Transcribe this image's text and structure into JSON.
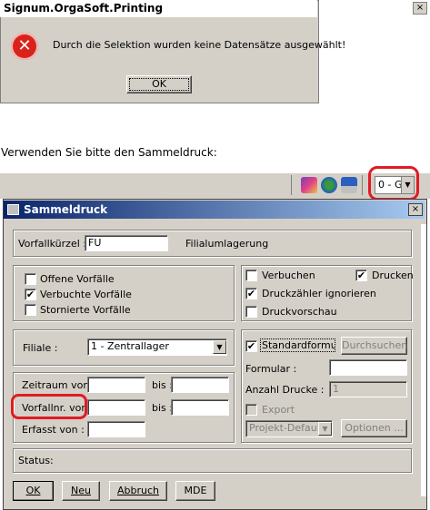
{
  "message_box": {
    "title": "Signum.OrgaSoft.Printing",
    "close": "×",
    "error_icon": "error-icon",
    "message": "Durch die Selektion wurden keine Datensätze ausgewählt!",
    "ok": "OK"
  },
  "intro_text": "Verwenden Sie bitte den Sammeldruck:",
  "toolbar": {
    "icons": [
      "book-icon",
      "refresh-icon",
      "print-icon"
    ],
    "combo_value": "0 - G",
    "arrow": "▼"
  },
  "dialog": {
    "title": "Sammeldruck",
    "close": "×",
    "vorfallkuerzel_label": "Vorfallkürzel :",
    "vorfallkuerzel_value": "FU",
    "vorfallkuerzel_desc": "Filialumlagerung",
    "status_checks": [
      {
        "label": "Offene Vorfälle",
        "checked": false
      },
      {
        "label": "Verbuchte Vorfälle",
        "checked": true
      },
      {
        "label": "Stornierte Vorfälle",
        "checked": false
      }
    ],
    "right_checks": {
      "verbuchen": {
        "label": "Verbuchen",
        "checked": false
      },
      "drucken": {
        "label": "Drucken",
        "checked": true
      },
      "druckzaehler": {
        "label": "Druckzähler ignorieren",
        "checked": true
      },
      "druckvorschau": {
        "label": "Druckvorschau",
        "checked": false
      }
    },
    "filiale_label": "Filiale :",
    "filiale_value": "1 - Zentrallager",
    "zeitraum_label": "Zeitraum von :",
    "bis1_label": "bis :",
    "vorfallnr_label": "Vorfallnr. von :",
    "bis2_label": "bis :",
    "erfasst_label": "Erfasst von :",
    "standardformular_label": "Standardformular",
    "standardformular_checked": true,
    "durchsuchen": "Durchsuchen",
    "formular_label": "Formular :",
    "anzahl_label": "Anzahl Drucke :",
    "anzahl_value": "1",
    "export_label": "Export",
    "projekt_value": "Projekt-Default",
    "optionen": "Optionen ...",
    "status_label": "Status:",
    "buttons": {
      "ok": "OK",
      "neu": "Neu",
      "abbruch": "Abbruch",
      "mde": "MDE"
    },
    "check_mark": "✔"
  },
  "colors": {
    "highlight": "#e01b24",
    "title_bar": "#0a246a",
    "error": "#d8231c"
  }
}
